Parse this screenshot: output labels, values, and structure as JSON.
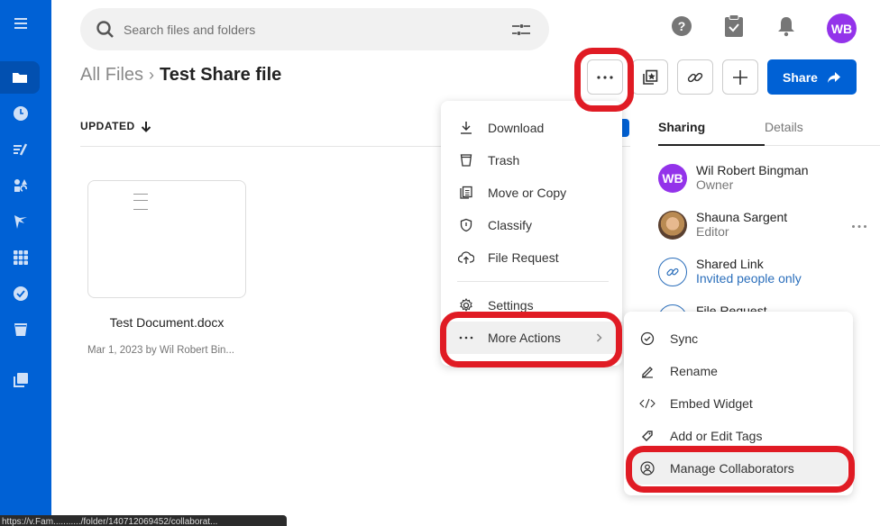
{
  "sidebar": {
    "items": [
      {
        "icon": "menu-icon",
        "label": "Menu"
      },
      {
        "icon": "folder-icon",
        "label": "All Files",
        "active": true
      },
      {
        "icon": "clock-icon",
        "label": "Recents"
      },
      {
        "icon": "notes-icon",
        "label": "Notes"
      },
      {
        "icon": "apps-icon",
        "label": "Relay"
      },
      {
        "icon": "canvas-icon",
        "label": "Canvas"
      },
      {
        "icon": "grid-icon",
        "label": "Apps"
      },
      {
        "icon": "check-circle-icon",
        "label": "Tasks"
      },
      {
        "icon": "trash-icon",
        "label": "Trash"
      },
      {
        "icon": "collections-icon",
        "label": "Collections"
      }
    ]
  },
  "search": {
    "placeholder": "Search files and folders",
    "value": ""
  },
  "header_icons": [
    "help-icon",
    "clipboard-check-icon",
    "bell-icon"
  ],
  "user": {
    "initials": "WB",
    "color": "#9333ea"
  },
  "breadcrumb": {
    "root": "All Files",
    "separator": "›",
    "current": "Test Share file"
  },
  "toolbar": {
    "more_label": "···",
    "share_label": "Share"
  },
  "sort": {
    "label": "UPDATED"
  },
  "files": [
    {
      "name": "Test Document.docx",
      "meta": "Mar 1, 2023 by Wil Robert Bin..."
    }
  ],
  "context_menu": {
    "items": [
      {
        "icon": "download-icon",
        "label": "Download"
      },
      {
        "icon": "trash-icon",
        "label": "Trash"
      },
      {
        "icon": "move-copy-icon",
        "label": "Move or Copy"
      },
      {
        "icon": "shield-icon",
        "label": "Classify"
      },
      {
        "icon": "upload-cloud-icon",
        "label": "File Request"
      },
      {
        "icon": "gear-icon",
        "label": "Settings"
      },
      {
        "icon": "more-icon",
        "label": "More Actions",
        "submenu": true
      }
    ]
  },
  "submenu": {
    "items": [
      {
        "icon": "sync-icon",
        "label": "Sync"
      },
      {
        "icon": "pencil-icon",
        "label": "Rename"
      },
      {
        "icon": "code-icon",
        "label": "Embed Widget"
      },
      {
        "icon": "tag-icon",
        "label": "Add or Edit Tags"
      },
      {
        "icon": "user-circle-icon",
        "label": "Manage Collaborators",
        "highlighted": true
      }
    ]
  },
  "panel": {
    "tabs": [
      {
        "label": "Sharing",
        "active": true
      },
      {
        "label": "Details"
      }
    ],
    "people": [
      {
        "initials": "WB",
        "name": "Wil Robert Bingman",
        "role": "Owner"
      },
      {
        "name": "Shauna Sargent",
        "role": "Editor"
      }
    ],
    "shared_link": {
      "title": "Shared Link",
      "subtitle": "Invited people only"
    },
    "file_request": {
      "title": "File Request"
    }
  },
  "status_bar": {
    "url": "https://v.Fam.........../folder/140712069452/collaborat..."
  },
  "colors": {
    "brand": "#0061d5",
    "highlight": "#e01b24",
    "avatar": "#9333ea",
    "link": "#2a6ebb"
  }
}
